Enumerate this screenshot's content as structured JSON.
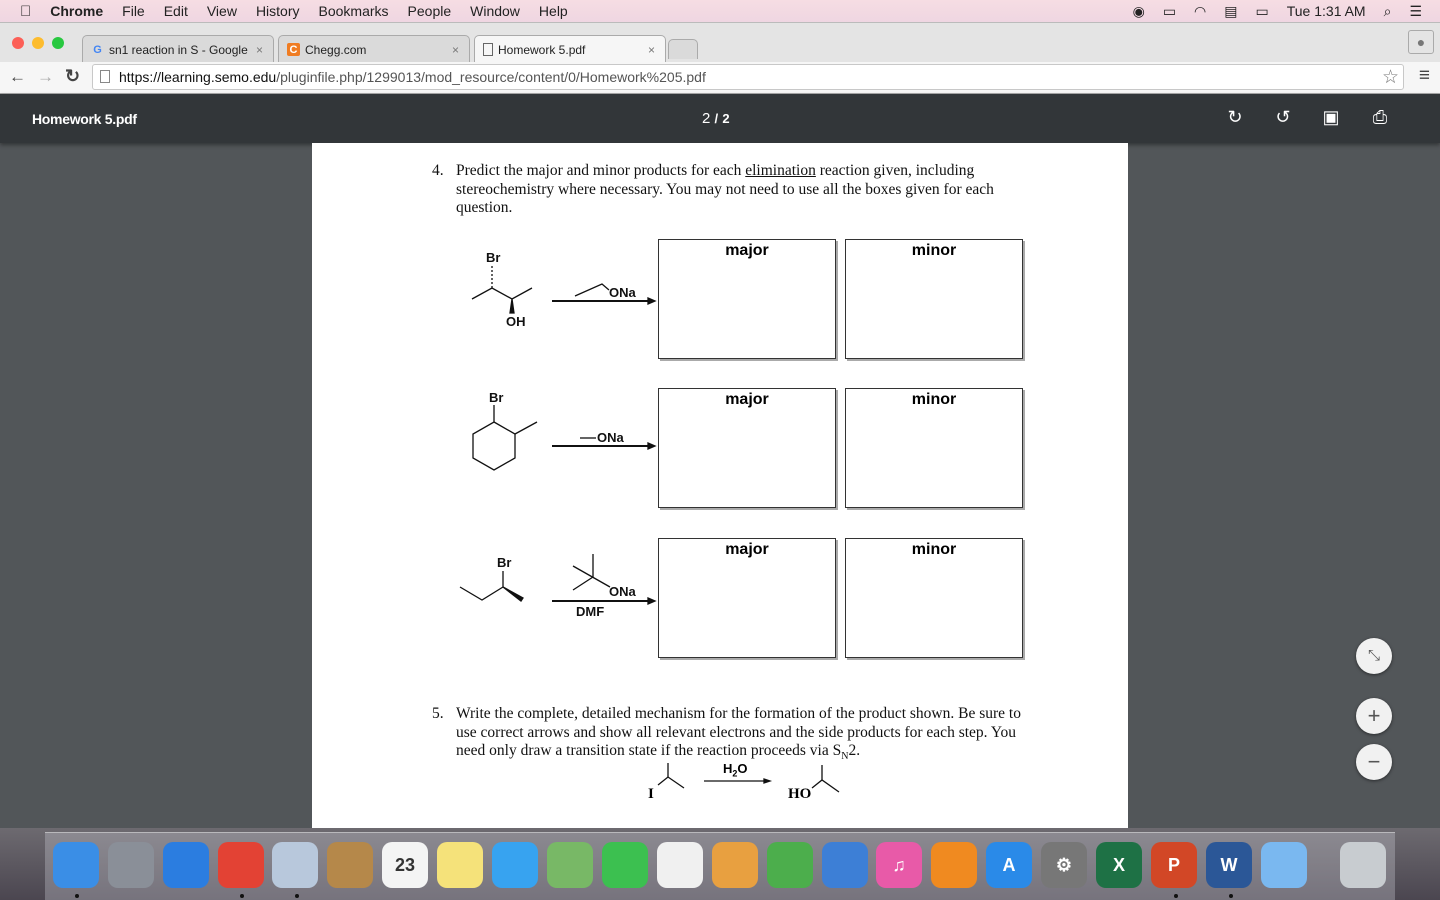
{
  "menubar": {
    "app": "Chrome",
    "items": [
      "File",
      "Edit",
      "View",
      "History",
      "Bookmarks",
      "People",
      "Window",
      "Help"
    ],
    "clock": "Tue 1:31 AM"
  },
  "tabs": [
    {
      "label": "sn1 reaction in S - Google",
      "icon": "google-icon"
    },
    {
      "label": "Chegg.com",
      "icon": "chegg-icon"
    },
    {
      "label": "Homework 5.pdf",
      "icon": "document-icon"
    }
  ],
  "address": {
    "host": "https://learning.semo.edu",
    "path": "/pluginfile.php/1299013/mod_resource/content/0/Homework%205.pdf"
  },
  "pdf": {
    "title": "Homework 5.pdf",
    "page": "2",
    "sep": "/",
    "total": "2"
  },
  "doc": {
    "q4": {
      "num": "4.",
      "text_before": "Predict the major and minor products for each ",
      "underlined": "elimination",
      "text_after": " reaction given, including stereochemistry where necessary. You may not need to use all the boxes given for each question."
    },
    "rows": [
      {
        "reagent": "ONa",
        "solvent": "",
        "sub_labels": [
          "Br",
          "OH"
        ],
        "major": "major",
        "minor": "minor"
      },
      {
        "reagent": "ONa",
        "solvent": "",
        "sub_labels": [
          "Br"
        ],
        "major": "major",
        "minor": "minor"
      },
      {
        "reagent": "ONa",
        "solvent": "DMF",
        "sub_labels": [
          "Br"
        ],
        "major": "major",
        "minor": "minor"
      }
    ],
    "q5": {
      "num": "5.",
      "text": "Write the complete, detailed mechanism for the formation of the product shown. Be sure to use correct arrows and show all relevant electrons and the side products for each step. You need only draw a transition state if the reaction proceeds via S",
      "sub": "N",
      "text_end": "2.",
      "reagent": "H",
      "reagent_sub": "2",
      "reagent_end": "O",
      "reactant_label": "I",
      "product_label": "HO"
    }
  },
  "zoom": {
    "fit": "⤡",
    "plus": "+",
    "minus": "−"
  },
  "dock": [
    {
      "name": "finder",
      "color": "#3a8ee6",
      "label": ""
    },
    {
      "name": "launchpad",
      "color": "#8a8f98",
      "label": ""
    },
    {
      "name": "safari",
      "color": "#2b7de0",
      "label": ""
    },
    {
      "name": "chrome",
      "color": "#e34234",
      "label": ""
    },
    {
      "name": "mail",
      "color": "#b8c8dc",
      "label": ""
    },
    {
      "name": "contacts",
      "color": "#b5884a",
      "label": ""
    },
    {
      "name": "calendar",
      "color": "#f4f4f4",
      "label": "23"
    },
    {
      "name": "notes",
      "color": "#f5e27a",
      "label": ""
    },
    {
      "name": "messages",
      "color": "#37a3f0",
      "label": ""
    },
    {
      "name": "maps",
      "color": "#78b866",
      "label": ""
    },
    {
      "name": "facetime",
      "color": "#3cc050",
      "label": ""
    },
    {
      "name": "photos",
      "color": "#f0f0f0",
      "label": ""
    },
    {
      "name": "pages",
      "color": "#e8a040",
      "label": ""
    },
    {
      "name": "numbers",
      "color": "#4cae4c",
      "label": ""
    },
    {
      "name": "keynote",
      "color": "#3d7fd6",
      "label": ""
    },
    {
      "name": "itunes",
      "color": "#e85aa8",
      "label": "♫"
    },
    {
      "name": "ibooks",
      "color": "#f08a20",
      "label": ""
    },
    {
      "name": "app-store",
      "color": "#2a8ae8",
      "label": "A"
    },
    {
      "name": "system-preferences",
      "color": "#777",
      "label": "⚙"
    },
    {
      "name": "excel",
      "color": "#1e7145",
      "label": "X"
    },
    {
      "name": "powerpoint",
      "color": "#d24726",
      "label": "P"
    },
    {
      "name": "word",
      "color": "#2b5797",
      "label": "W"
    },
    {
      "name": "icloud",
      "color": "#7ab8f0",
      "label": ""
    },
    {
      "name": "trash",
      "color": "#c8ccd0",
      "label": ""
    }
  ]
}
